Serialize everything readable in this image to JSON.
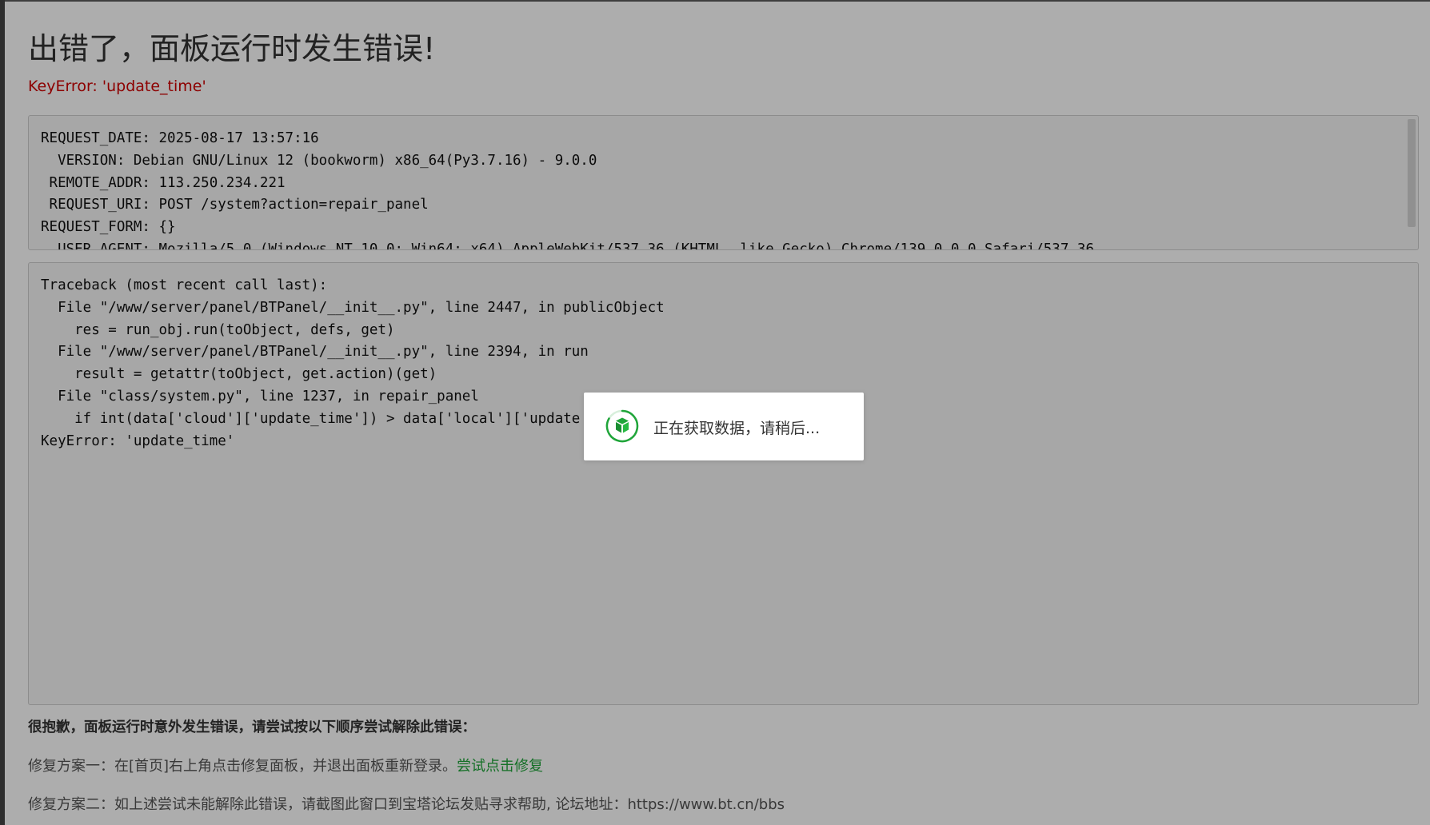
{
  "page": {
    "title": "出错了，面板运行时发生错误!",
    "error_message": "KeyError: 'update_time'"
  },
  "request_info": {
    "lines": [
      "REQUEST_DATE: 2025-08-17 13:57:16",
      "  VERSION: Debian GNU/Linux 12 (bookworm) x86_64(Py3.7.16) - 9.0.0",
      " REMOTE_ADDR: 113.250.234.221",
      " REQUEST_URI: POST /system?action=repair_panel",
      "REQUEST_FORM: {}",
      "  USER_AGENT: Mozilla/5.0 (Windows NT 10.0; Win64; x64) AppleWebKit/537.36 (KHTML, like Gecko) Chrome/139.0.0.0 Safari/537.36"
    ]
  },
  "traceback": {
    "lines": [
      "Traceback (most recent call last):",
      "  File \"/www/server/panel/BTPanel/__init__.py\", line 2447, in publicObject",
      "    res = run_obj.run(toObject, defs, get)",
      "  File \"/www/server/panel/BTPanel/__init__.py\", line 2394, in run",
      "    result = getattr(toObject, get.action)(get)",
      "  File \"class/system.py\", line 1237, in repair_panel",
      "    if int(data['cloud']['update_time']) > data['local']['update",
      "KeyError: 'update_time'"
    ]
  },
  "help": {
    "heading": "很抱歉，面板运行时意外发生错误，请尝试按以下顺序尝试解除此错误：",
    "fix1_text": "修复方案一：在[首页]右上角点击修复面板，并退出面板重新登录。",
    "fix1_link": "尝试点击修复",
    "fix2_text": "修复方案二：如上述尝试未能解除此错误，请截图此窗口到宝塔论坛发贴寻求帮助, 论坛地址：https://www.bt.cn/bbs"
  },
  "loading": {
    "text": "正在获取数据，请稍后...",
    "icon": "bt-logo-spinner-icon"
  },
  "colors": {
    "error": "#d00000",
    "link": "#20a53a",
    "overlay": "rgba(0,0,0,0.32)"
  }
}
